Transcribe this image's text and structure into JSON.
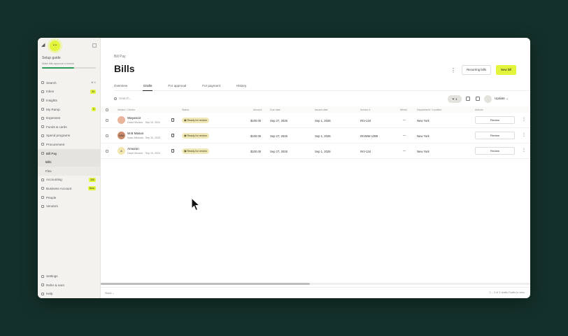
{
  "sidebar": {
    "setup": {
      "title": "Setup guide",
      "subtitle": "Make bills approval a breeze",
      "progress": 0.6
    },
    "items": [
      {
        "label": "Search",
        "shortcut": "⌘ K"
      },
      {
        "label": "Inbox",
        "badge": "34"
      },
      {
        "label": "Insights"
      },
      {
        "label": "My Ramp",
        "badge": "5"
      },
      {
        "label": "Expenses"
      },
      {
        "label": "Funds & cards"
      },
      {
        "label": "Spend programs"
      },
      {
        "label": "Procurement"
      },
      {
        "label": "Bill Pay"
      },
      {
        "label": "Bills"
      },
      {
        "label": "Flex"
      },
      {
        "label": "Accounting",
        "badge": "350"
      },
      {
        "label": "Business Account",
        "badge": "New"
      },
      {
        "label": "People"
      },
      {
        "label": "Vendors"
      }
    ],
    "bottom": [
      {
        "label": "Settings"
      },
      {
        "label": "Refer & earn"
      },
      {
        "label": "Help"
      }
    ]
  },
  "main": {
    "breadcrumb": "Bill Pay",
    "title": "Bills",
    "more": "⋮",
    "recurring_label": "Recurring bills",
    "new_bill_label": "New bill",
    "tabs": [
      "Overview",
      "Drafts",
      "For approval",
      "For payment",
      "History"
    ],
    "search_placeholder": "Search...",
    "filter_count": "1",
    "update_label": "Update",
    "columns": [
      "Vendor / Owner",
      "Status",
      "Amount",
      "Due date",
      "Issued date",
      "Invoice #",
      "Memo",
      "Department / Location",
      "Actions"
    ],
    "rows": [
      {
        "initials": "",
        "avatar_color": "#e9b49b",
        "vendor": "Wayanoir",
        "owner": "David Murane · Sep 10, 2024",
        "status": "Ready for review",
        "amount": "$100.00",
        "due": "Sep 27, 2026",
        "issued": "Sep 1, 2026",
        "invoice": "INV-134",
        "memo": "—",
        "location": "New York",
        "action": "Review",
        "rmore": "⋮"
      },
      {
        "initials": "WM",
        "avatar_color": "#c98a6a",
        "vendor": "W.B Mason",
        "owner": "Isaac Miranda · Sep 10, 2024",
        "status": "Ready for review",
        "amount": "$100.00",
        "due": "Sep 27, 2026",
        "issued": "Sep 1, 2026",
        "invoice": "INVMW-1089",
        "memo": "—",
        "location": "New York",
        "action": "Review",
        "rmore": "⋮"
      },
      {
        "initials": "A",
        "avatar_color": "#f1e6b0",
        "vendor": "Amazon",
        "owner": "David Murane · Sep 10, 2024",
        "status": "Ready for review",
        "amount": "$100.00",
        "due": "Sep 27, 2026",
        "issued": "Sep 1, 2026",
        "invoice": "INV-134",
        "memo": "—",
        "location": "New York",
        "action": "Review",
        "rmore": "⋮"
      }
    ]
  },
  "footer": {
    "left": "Stack ⌄",
    "right": "1 – 3 of 3 drafts   Drafts to view"
  },
  "colors": {
    "accent": "#e2f53a",
    "status_bg": "#f0e7b6",
    "backdrop": "#14302a"
  }
}
